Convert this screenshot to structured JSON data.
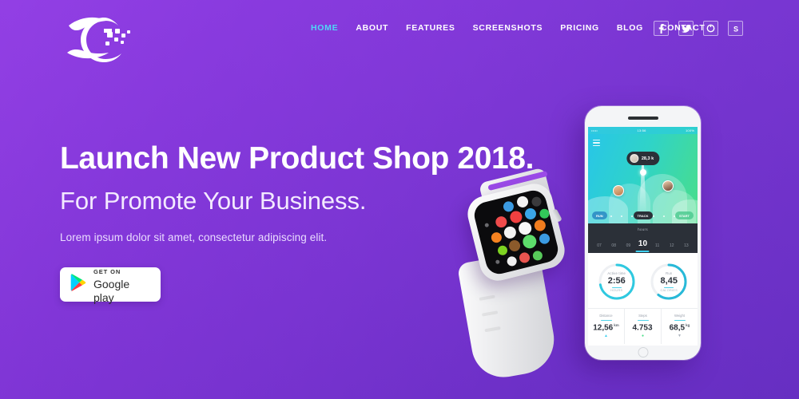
{
  "brand": {
    "logo_alt": "company-logo"
  },
  "nav": {
    "items": [
      {
        "label": "HOME",
        "active": true
      },
      {
        "label": "ABOUT",
        "active": false
      },
      {
        "label": "FEATURES",
        "active": false
      },
      {
        "label": "SCREENSHOTS",
        "active": false
      },
      {
        "label": "PRICING",
        "active": false
      },
      {
        "label": "BLOG",
        "active": false
      },
      {
        "label": "CONTACT",
        "active": false
      }
    ],
    "active_color": "#4fd8f6",
    "color": "#ffffff"
  },
  "socials": [
    {
      "name": "facebook-icon",
      "glyph": "f"
    },
    {
      "name": "twitter-icon",
      "glyph": "t"
    },
    {
      "name": "dribbble-icon",
      "glyph": "o"
    },
    {
      "name": "skype-icon",
      "glyph": "s"
    }
  ],
  "hero": {
    "headline": "Launch New Product Shop 2018.",
    "subheadline": "For Promote Your Business.",
    "paragraph": "Lorem ipsum dolor sit amet, consectetur adipiscing elit.",
    "background_from": "#9a41ea",
    "background_to": "#5f2bbc"
  },
  "cta": {
    "store_small": "GET ON",
    "store_large": "Google play",
    "icon": "google-play-icon"
  },
  "phone": {
    "statusbar": {
      "carrier": "•••••",
      "time": "13:56",
      "battery": "100%"
    },
    "map": {
      "tooltip_value": "28,3 k",
      "chip_left": "RUN",
      "chip_mid": "TRACK",
      "chip_right": "START"
    },
    "hours": {
      "label": "hours",
      "values": [
        "07",
        "08",
        "09",
        "10",
        "11",
        "12",
        "13"
      ],
      "selected": "10",
      "accent": "#3fd0f0"
    },
    "gauges": [
      {
        "caption": "Active time",
        "value": "2:56",
        "unit": "HOURS",
        "pct": 72,
        "color": "#2fc9e0"
      },
      {
        "caption": "Run",
        "value": "8,45",
        "unit": "CALORIES",
        "pct": 60,
        "color": "#28b9d8"
      }
    ],
    "stats": [
      {
        "caption": "Distance",
        "value": "12,56",
        "unit": "km",
        "icon": "▲",
        "icon_color": "#3fd0f0"
      },
      {
        "caption": "Steps",
        "value": "4.753",
        "unit": "",
        "icon": "●",
        "icon_color": "#4ade88"
      },
      {
        "caption": "Weight",
        "value": "68,5",
        "unit": "kg",
        "icon": "▼",
        "icon_color": "#9aa1ac"
      }
    ]
  },
  "watch": {
    "name": "smartwatch-product-image",
    "app_grid_label": "app-grid"
  }
}
